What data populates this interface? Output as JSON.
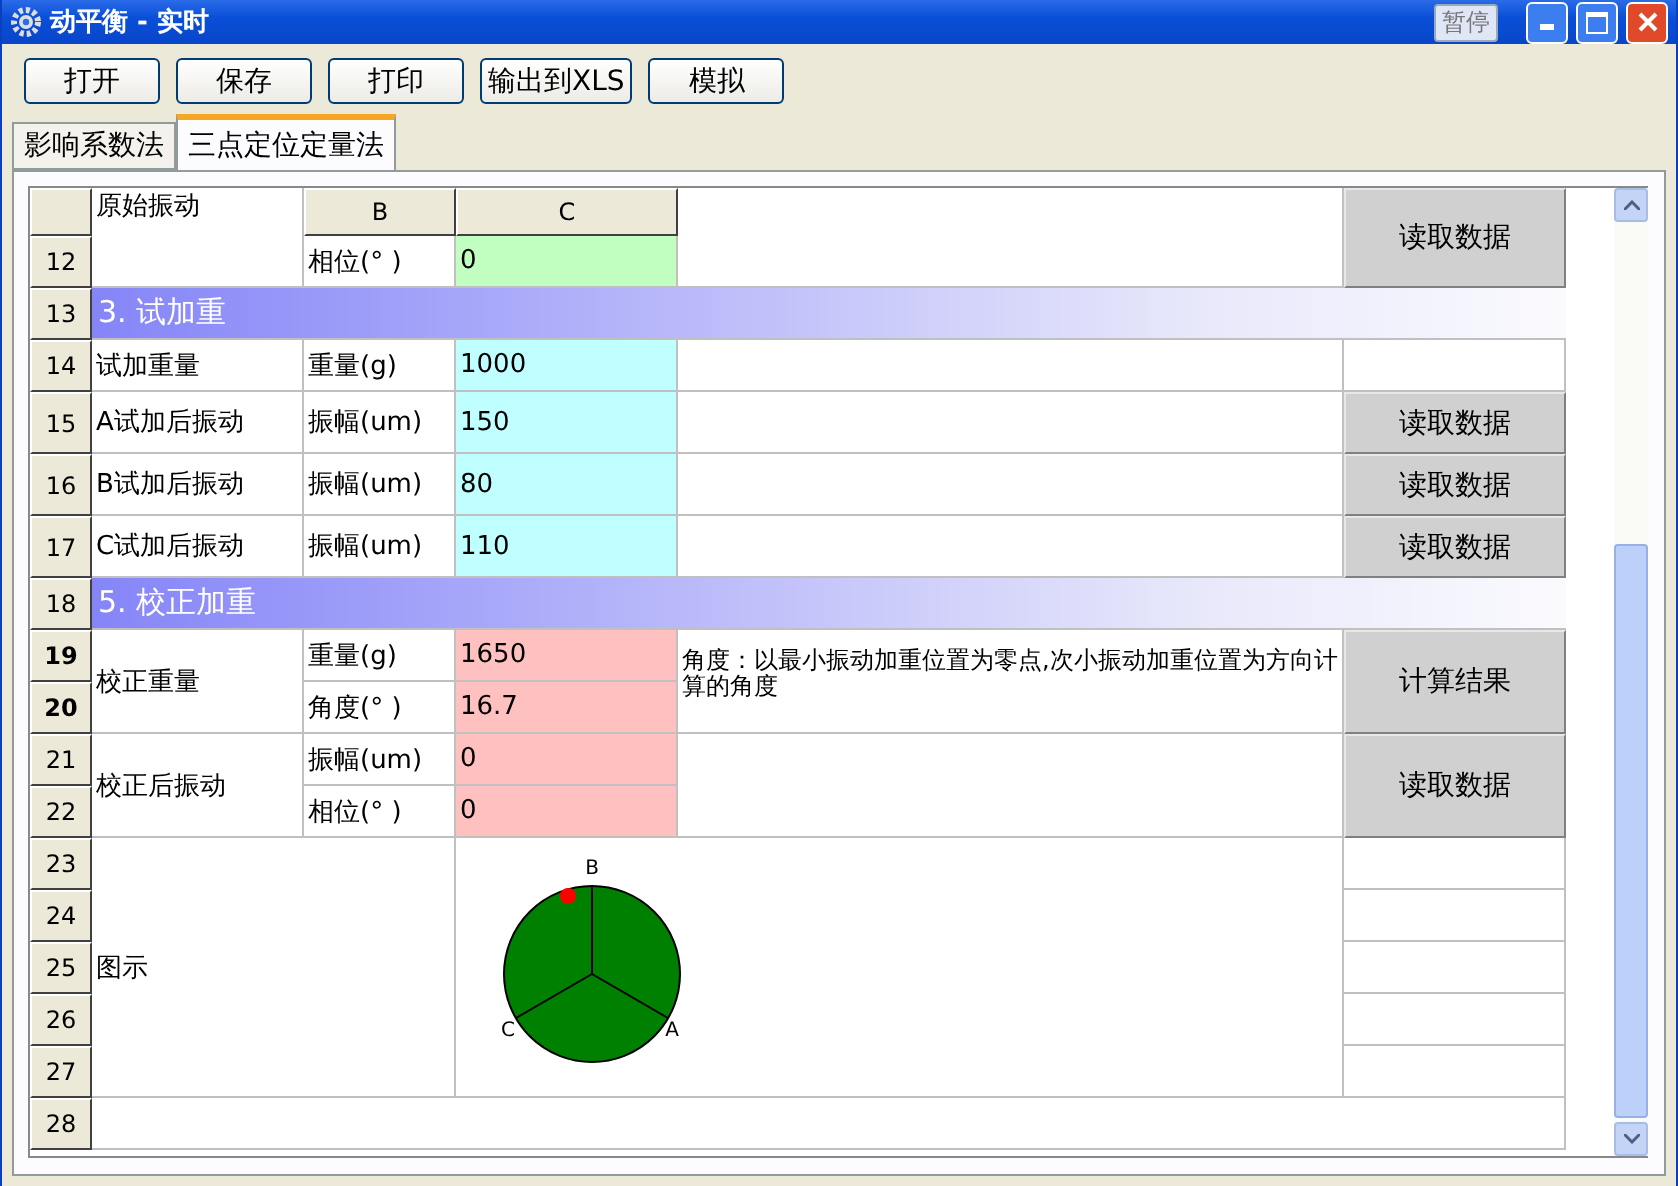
{
  "window": {
    "title": "动平衡 - 实时",
    "pause_button": "暂停"
  },
  "toolbar": [
    "打开",
    "保存",
    "打印",
    "输出到XLS",
    "模拟"
  ],
  "tabs": [
    {
      "label": "影响系数法",
      "selected": false
    },
    {
      "label": "三点定位定量法",
      "selected": true
    }
  ],
  "sheet": {
    "columns": [
      "B",
      "C"
    ],
    "row_headers": [
      {
        "label": "12",
        "selected": false
      },
      {
        "label": "13",
        "selected": false
      },
      {
        "label": "14",
        "selected": false
      },
      {
        "label": "15",
        "selected": false
      },
      {
        "label": "16",
        "selected": false
      },
      {
        "label": "17",
        "selected": false
      },
      {
        "label": "18",
        "selected": false
      },
      {
        "label": "19",
        "selected": true
      },
      {
        "label": "20",
        "selected": true
      },
      {
        "label": "21",
        "selected": false
      },
      {
        "label": "22",
        "selected": false
      },
      {
        "label": "23",
        "selected": false
      },
      {
        "label": "24",
        "selected": false
      },
      {
        "label": "25",
        "selected": false
      },
      {
        "label": "26",
        "selected": false
      },
      {
        "label": "27",
        "selected": false
      },
      {
        "label": "28",
        "selected": false
      }
    ],
    "original_vibration": {
      "label": "原始振动",
      "unit": "相位(° )",
      "value": "0",
      "button": "读取数据"
    },
    "sections": [
      "3. 试加重",
      "5. 校正加重"
    ],
    "trial_rows": [
      {
        "label": "试加重量",
        "unit": "重量(g)",
        "value": "1000"
      },
      {
        "label": "A试加后振动",
        "unit": "振幅(um)",
        "value": "150",
        "button": "读取数据"
      },
      {
        "label": "B试加后振动",
        "unit": "振幅(um)",
        "value": "80",
        "button": "读取数据"
      },
      {
        "label": "C试加后振动",
        "unit": "振幅(um)",
        "value": "110",
        "button": "读取数据"
      }
    ],
    "correction": {
      "label": "校正重量",
      "fields": [
        {
          "unit": "重量(g)",
          "value": "1650"
        },
        {
          "unit": "角度(° )",
          "value": "16.7"
        }
      ],
      "note": "角度：以最小振动加重位置为零点,次小振动加重位置为方向计算的角度",
      "button": "计算结果"
    },
    "after_correction": {
      "label": "校正后振动",
      "fields": [
        {
          "unit": "振幅(um)",
          "value": "0"
        },
        {
          "unit": "相位(° )",
          "value": "0"
        }
      ],
      "button": "读取数据"
    },
    "diagram": {
      "label": "图示",
      "points": [
        "B",
        "A",
        "C"
      ]
    }
  }
}
